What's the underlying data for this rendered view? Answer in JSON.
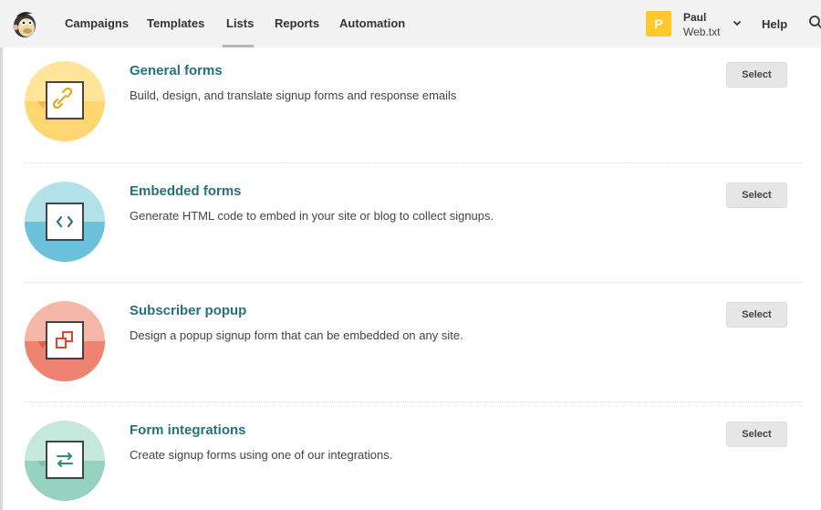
{
  "header": {
    "nav": [
      "Campaigns",
      "Templates",
      "Lists",
      "Reports",
      "Automation"
    ],
    "active_nav": "Lists",
    "user": {
      "avatar_letter": "P",
      "name": "Paul",
      "org": "Web.txt"
    },
    "help_label": "Help",
    "icons": {
      "logo": "mailchimp-logo-icon",
      "account_menu": "chevron-down-icon",
      "search": "search-icon"
    }
  },
  "forms": [
    {
      "title": "General forms",
      "description": "Build, design, and translate signup forms and response emails",
      "button": "Select",
      "icon": "link-icon",
      "colors": {
        "light": "#ffe49a",
        "dark": "#ffd66f",
        "icon": "#e0a91a"
      }
    },
    {
      "title": "Embedded forms",
      "description": "Generate HTML code to embed in your site or blog to collect signups.",
      "button": "Select",
      "icon": "code-icon",
      "colors": {
        "light": "#b3e1ea",
        "dark": "#6cc2da",
        "icon": "#2c6f86"
      }
    },
    {
      "title": "Subscriber popup",
      "description": "Design a popup signup form that can be embedded on any site.",
      "button": "Select",
      "icon": "popup-icon",
      "colors": {
        "light": "#f5b7a8",
        "dark": "#ef8270",
        "icon": "#d9472d"
      }
    },
    {
      "title": "Form integrations",
      "description": "Create signup forms using one of our integrations.",
      "button": "Select",
      "icon": "swap-arrows-icon",
      "colors": {
        "light": "#c5e7dc",
        "dark": "#97d2c0",
        "icon": "#2b8f74"
      }
    }
  ]
}
